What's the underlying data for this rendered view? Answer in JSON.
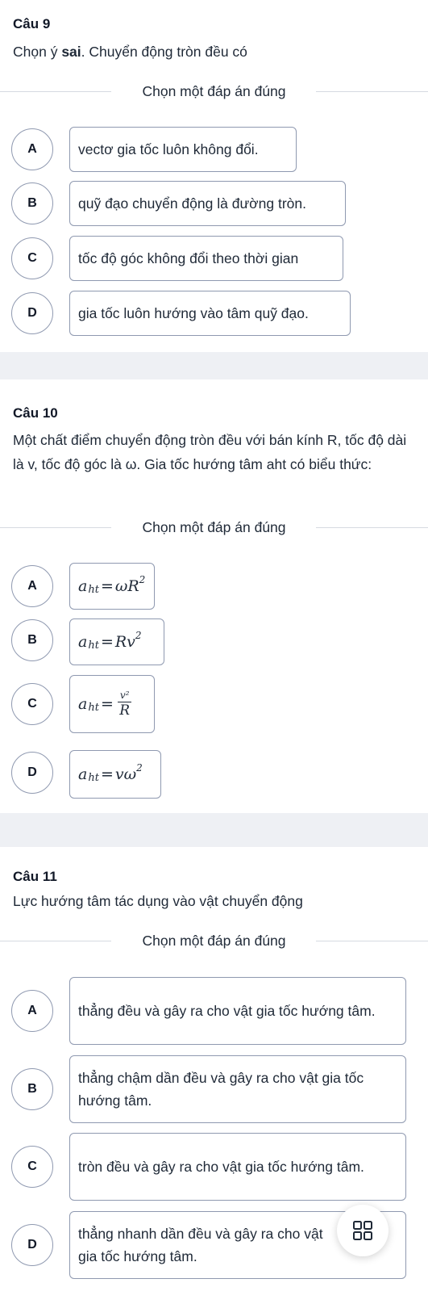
{
  "choose_label": "Chọn một đáp án đúng",
  "questions": [
    {
      "title": "Câu 9",
      "text_pre": "Chọn ý ",
      "text_bold": "sai",
      "text_post": ". Chuyển động tròn đều có",
      "options": [
        {
          "letter": "A",
          "text": "vectơ gia tốc luôn không đổi."
        },
        {
          "letter": "B",
          "text": "quỹ đạo chuyển động là đường tròn."
        },
        {
          "letter": "C",
          "text": "tốc độ góc không đổi theo thời gian"
        },
        {
          "letter": "D",
          "text": "gia tốc luôn hướng vào tâm quỹ đạo."
        }
      ]
    },
    {
      "title": "Câu 10",
      "text": "Một chất điểm chuyển động tròn đều với bán kính R, tốc độ dài là v, tốc độ góc là ω. Gia tốc hướng tâm aht có biểu thức:",
      "options": [
        {
          "letter": "A",
          "formula": {
            "var": "a",
            "sub": "ht",
            "eq": "=",
            "rhs": "ωR",
            "sup": "2"
          }
        },
        {
          "letter": "B",
          "formula": {
            "var": "a",
            "sub": "ht",
            "eq": "=",
            "rhs": "Rv",
            "sup": "2"
          }
        },
        {
          "letter": "C",
          "formula": {
            "var": "a",
            "sub": "ht",
            "eq": "=",
            "num": "v²",
            "den": "R"
          }
        },
        {
          "letter": "D",
          "formula": {
            "var": "a",
            "sub": "ht",
            "eq": "=",
            "rhs": "vω",
            "sup": "2"
          }
        }
      ]
    },
    {
      "title": "Câu 11",
      "text": "Lực hướng tâm tác dụng vào vật chuyển động",
      "options": [
        {
          "letter": "A",
          "text": "thẳng đều và gây ra cho vật gia tốc hướng tâm."
        },
        {
          "letter": "B",
          "text": "thẳng chậm dần đều và gây ra cho vật gia tốc hướng tâm."
        },
        {
          "letter": "C",
          "text": "tròn đều và gây ra cho vật gia tốc hướng tâm."
        },
        {
          "letter": "D",
          "text": "thẳng nhanh dần đều và gây ra cho vật gia tốc hướng tâm."
        }
      ]
    }
  ],
  "fab_icon": "grid-icon"
}
